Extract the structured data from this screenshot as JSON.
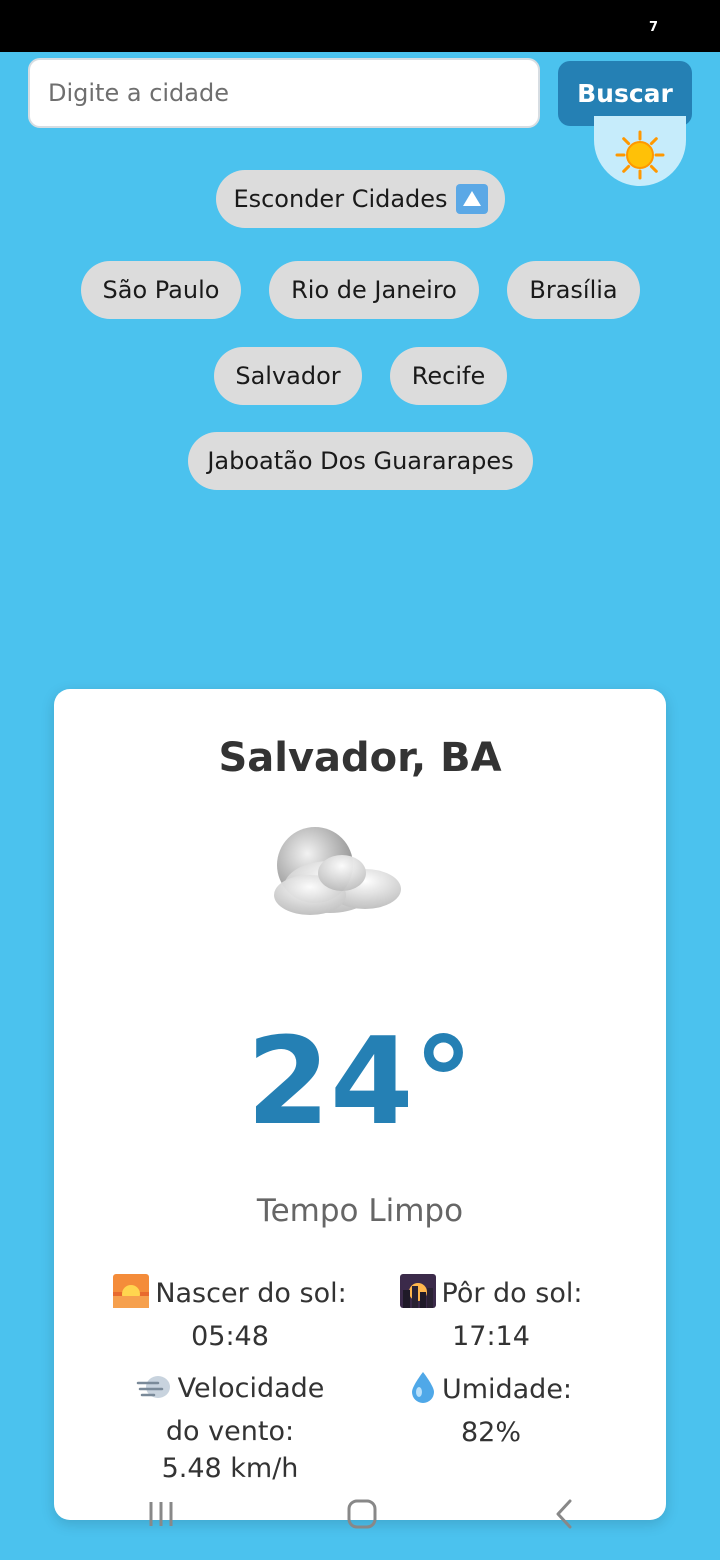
{
  "status_bar": {
    "indicator": "7"
  },
  "search": {
    "placeholder": "Digite a cidade",
    "value": "",
    "button_label": "Buscar"
  },
  "theme_toggle": {
    "icon": "sun-icon"
  },
  "cities_toggle": {
    "label": "Esconder Cidades",
    "icon": "arrow-up-icon"
  },
  "cities": [
    "São Paulo",
    "Rio de Janeiro",
    "Brasília",
    "Salvador",
    "Recife",
    "Jaboatão Dos Guararapes"
  ],
  "weather": {
    "city": "Salvador, BA",
    "icon": "partly-cloudy-icon",
    "temperature": "24°",
    "condition": "Tempo Limpo",
    "sunrise": {
      "label": "Nascer do sol:",
      "value": "05:48",
      "icon": "sunrise-icon"
    },
    "sunset": {
      "label": "Pôr do sol:",
      "value": "17:14",
      "icon": "sunset-icon"
    },
    "wind": {
      "label_line1": "Velocidade",
      "label_line2": "do vento:",
      "value": "5.48 km/h",
      "icon": "wind-icon"
    },
    "humidity": {
      "label": "Umidade:",
      "value": "82%",
      "icon": "droplet-icon"
    }
  },
  "colors": {
    "background": "#4BC2EE",
    "accent": "#2580B4",
    "chip": "#DCDCDC",
    "card": "#FFFFFF"
  },
  "nav": {
    "icons": [
      "recent-apps-icon",
      "home-icon",
      "back-icon"
    ]
  }
}
